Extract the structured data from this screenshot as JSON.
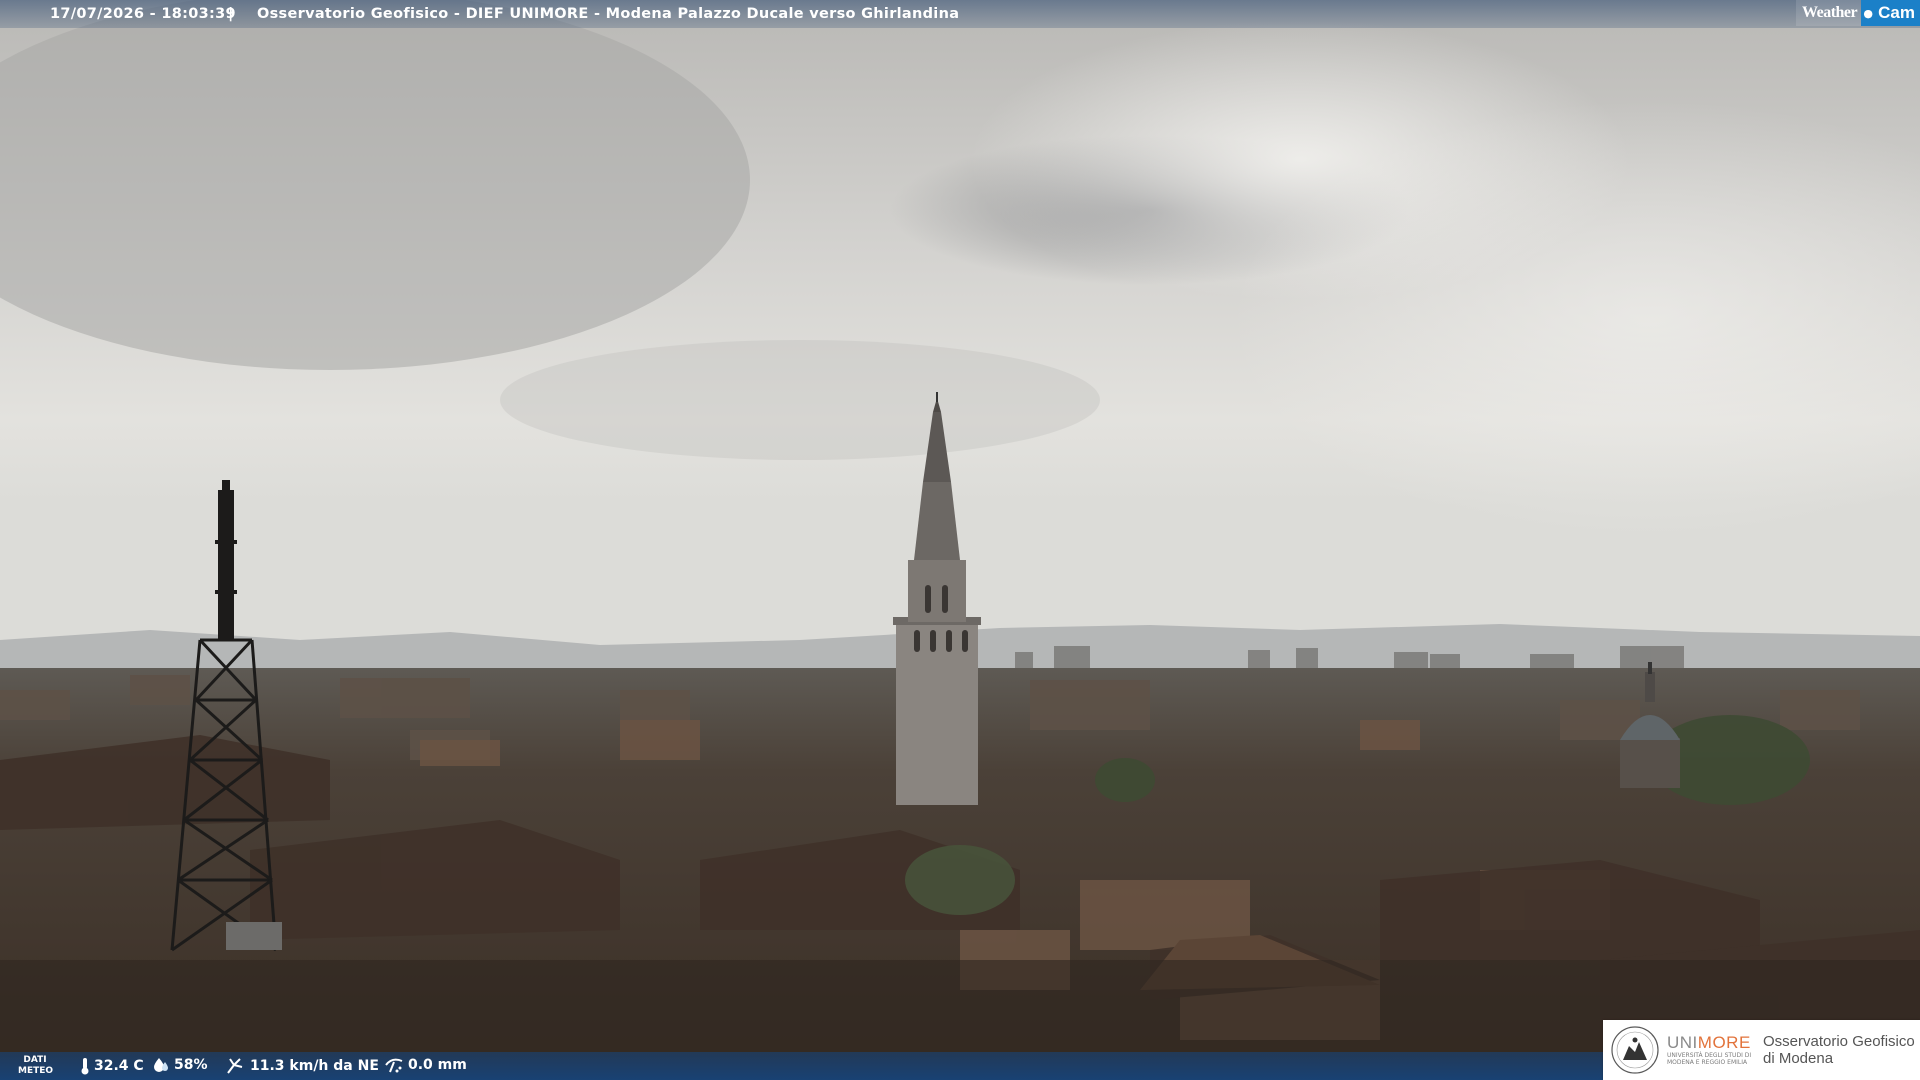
{
  "caption": {
    "timestamp": "17/07/2026 - 18:03:39",
    "separator": "|",
    "title": "Osservatorio Geofisico - DIEF UNIMORE - Modena Palazzo Ducale verso Ghirlandina"
  },
  "brand": {
    "weather": "Weather",
    "cam": "Cam"
  },
  "meteo": {
    "label_line1": "DATI",
    "label_line2": "METEO",
    "temperature": "32.4 C",
    "humidity": "58%",
    "wind": "11.3 km/h da NE",
    "rain": "0.0 mm",
    "icons": [
      "thermometer-icon",
      "humidity-drop-icon",
      "wind-icon",
      "rain-gauge-icon"
    ]
  },
  "logo": {
    "uni": "UNI",
    "more": "MORE",
    "subline": "UNIVERSITÀ DEGLI STUDI DI MODENA E REGGIO EMILIA",
    "obs_line1": "Osservatorio Geofisico",
    "obs_line2": "di Modena"
  },
  "colors": {
    "sky": "#d9d8d4",
    "roofs": "#4a3a2f",
    "bar": "#1b5fa0",
    "unimore_orange": "#e2733b"
  }
}
